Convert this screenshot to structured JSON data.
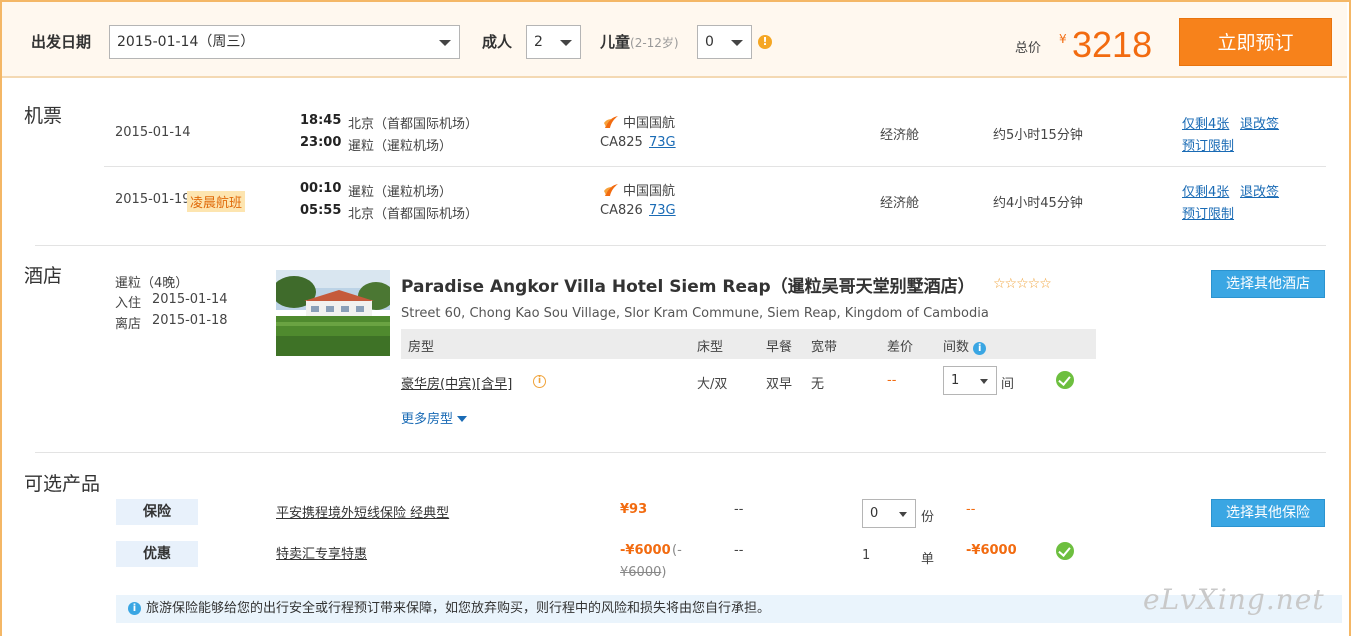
{
  "top_bar": {
    "depart_label": "出发日期",
    "depart_value": "2015-01-14（周三）",
    "adult_label": "成人",
    "adult_value": "2",
    "child_label": "儿童",
    "child_age_note": "(2-12岁)",
    "child_value": "0",
    "total_label": "总价",
    "currency": "¥",
    "total_value": "3218",
    "book_button": "立即预订"
  },
  "flights": {
    "section_title": "机票",
    "rows": [
      {
        "date": "2015-01-14",
        "tag": "",
        "dep_time": "18:45",
        "dep_place": "北京（首都国际机场）",
        "arr_time": "23:00",
        "arr_place": "暹粒（暹粒机场）",
        "airline": "中国国航",
        "flight_no": "CA825",
        "aircraft": "73G",
        "cabin": "经济舱",
        "duration": "约5小时15分钟",
        "seats_left": "仅剩4张",
        "change_policy": "退改签",
        "booking_limit": "预订限制"
      },
      {
        "date": "2015-01-19",
        "tag": "凌晨航班",
        "dep_time": "00:10",
        "dep_place": "暹粒（暹粒机场）",
        "arr_time": "05:55",
        "arr_place": "北京（首都国际机场）",
        "airline": "中国国航",
        "flight_no": "CA826",
        "aircraft": "73G",
        "cabin": "经济舱",
        "duration": "约4小时45分钟",
        "seats_left": "仅剩4张",
        "change_policy": "退改签",
        "booking_limit": "预订限制"
      }
    ]
  },
  "hotel": {
    "section_title": "酒店",
    "city": "暹粒（4晚）",
    "checkin_label": "入住",
    "checkin": "2015-01-14",
    "checkout_label": "离店",
    "checkout": "2015-01-18",
    "name": "Paradise Angkor Villa Hotel Siem Reap（暹粒吴哥天堂别墅酒店）",
    "stars": "☆☆☆☆☆",
    "address": "Street 60, Chong Kao Sou Village, Slor Kram Commune, Siem Reap, Kingdom of Cambodia",
    "other_hotel_button": "选择其他酒店",
    "room_headers": [
      "房型",
      "床型",
      "早餐",
      "宽带",
      "差价",
      "间数"
    ],
    "room": {
      "type": "豪华房(中宾)[含早]",
      "bed": "大/双",
      "breakfast": "双早",
      "broadband": "无",
      "price_diff": "--",
      "count": "1",
      "count_unit": "间"
    },
    "more_rooms": "更多房型"
  },
  "optional": {
    "section_title": "可选产品",
    "insurance": {
      "tag": "保险",
      "name": "平安携程境外短线保险 经典型",
      "price": "¥93",
      "dash": "--",
      "qty": "0",
      "unit": "份",
      "subtotal": "--",
      "button": "选择其他保险"
    },
    "promo": {
      "tag": "优惠",
      "name": "特卖汇专享特惠",
      "price": "-¥6000",
      "price_open": "(-",
      "price_orig": "¥6000",
      "price_close": ")",
      "dash": "--",
      "qty": "1",
      "unit": "单",
      "subtotal": "-¥6000"
    },
    "notice": "旅游保险能够给您的出行安全或行程预订带来保障，如您放弃购买，则行程中的风险和损失将由您自行承担。"
  },
  "watermark": "eLvXing.net"
}
